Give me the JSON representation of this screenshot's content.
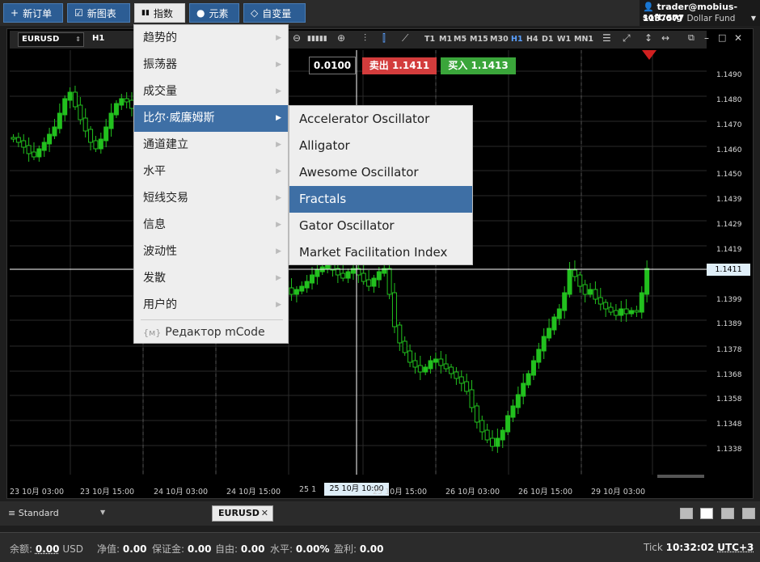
{
  "toolbar": {
    "new_order": "新订单",
    "new_chart": "新图表",
    "indicators": "指数",
    "elements": "元素",
    "custom_variables": "自变量"
  },
  "account": {
    "email": "trader@mobius-soft.org",
    "id": "1137577",
    "name": "Dollar Fund"
  },
  "chart": {
    "symbol": "EURUSD",
    "timeframe": "H1",
    "timeframes": [
      "T1",
      "M1",
      "M5",
      "M15",
      "M30",
      "H1",
      "H4",
      "D1",
      "W1",
      "MN1"
    ],
    "selected_timeframe": "H1",
    "lot": "0.0100",
    "sell_label": "卖出",
    "sell_price": "1.1411",
    "buy_label": "买入",
    "buy_price": "1.1413",
    "y_ticks": [
      "1.1490",
      "1.1480",
      "1.1470",
      "1.1460",
      "1.1450",
      "1.1439",
      "1.1429",
      "1.1419",
      "1.1399",
      "1.1389",
      "1.1378",
      "1.1368",
      "1.1358",
      "1.1348",
      "1.1338"
    ],
    "current_price": "1.1411",
    "x_ticks": [
      "23 10月 03:00",
      "23 10月 15:00",
      "24 10月 03:00",
      "24 10月 15:00",
      "25 1",
      "25 10月 15:00",
      "26 10月 03:00",
      "26 10月 15:00",
      "29 10月 03:00"
    ],
    "crosshair_time": "25 10月 10:00",
    "bull_color": "#22c01e",
    "bear_color": "#22c01e"
  },
  "menu": {
    "items": [
      "趋势的",
      "振荡器",
      "成交量",
      "比尔·威廉姆斯",
      "通道建立",
      "水平",
      "短线交易",
      "信息",
      "波动性",
      "发散",
      "用户的"
    ],
    "selected_index": 3,
    "mcode": "Редактор mCode"
  },
  "submenu": {
    "items": [
      "Accelerator Oscillator",
      "Alligator",
      "Awesome Oscillator",
      "Fractals",
      "Gator Oscillator",
      "Market Facilitation Index"
    ],
    "selected_index": 3
  },
  "bottom": {
    "profile": "Standard",
    "tab": "EURUSD"
  },
  "status": {
    "balance_label": "余额:",
    "balance": "0.00",
    "currency": "USD",
    "equity_label": "净值:",
    "equity": "0.00",
    "margin_label": "保证金:",
    "margin": "0.00",
    "free_label": "自由:",
    "free": "0.00",
    "level_label": "水平:",
    "level": "0.00%",
    "profit_label": "盈利:",
    "profit": "0.00",
    "tick_label": "Tick",
    "time": "10:32:02",
    "tz": "UTC+3"
  }
}
